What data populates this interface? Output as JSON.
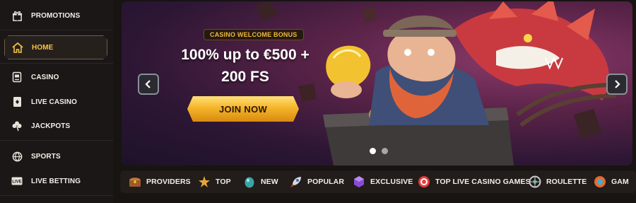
{
  "sidebar": {
    "items": [
      {
        "label": "PROMOTIONS",
        "icon": "gift-icon"
      },
      {
        "label": "HOME",
        "icon": "home-icon",
        "active": true
      },
      {
        "label": "CASINO",
        "icon": "slot-machine-icon"
      },
      {
        "label": "LIVE CASINO",
        "icon": "card-icon"
      },
      {
        "label": "JACKPOTS",
        "icon": "clover-icon"
      },
      {
        "label": "SPORTS",
        "icon": "basketball-icon"
      },
      {
        "label": "LIVE BETTING",
        "icon": "live-tv-icon"
      }
    ],
    "accent": "#f7c340"
  },
  "banner": {
    "tag": "CASINO WELCOME BONUS",
    "headline_line1": "100% up to €500 +",
    "headline_line2": "200 FS",
    "cta": "JOIN NOW",
    "slides": 2,
    "active_slide": 1
  },
  "categories": [
    {
      "label": "PROVIDERS",
      "icon": "chest-icon"
    },
    {
      "label": "TOP",
      "icon": "star-icon"
    },
    {
      "label": "NEW",
      "icon": "egg-icon"
    },
    {
      "label": "POPULAR",
      "icon": "rocket-icon"
    },
    {
      "label": "EXCLUSIVE",
      "icon": "gem-icon"
    },
    {
      "label": "TOP LIVE CASINO GAMES",
      "icon": "chip-icon"
    },
    {
      "label": "ROULETTE",
      "icon": "roulette-icon"
    },
    {
      "label": "GAM",
      "icon": "game-icon"
    }
  ]
}
